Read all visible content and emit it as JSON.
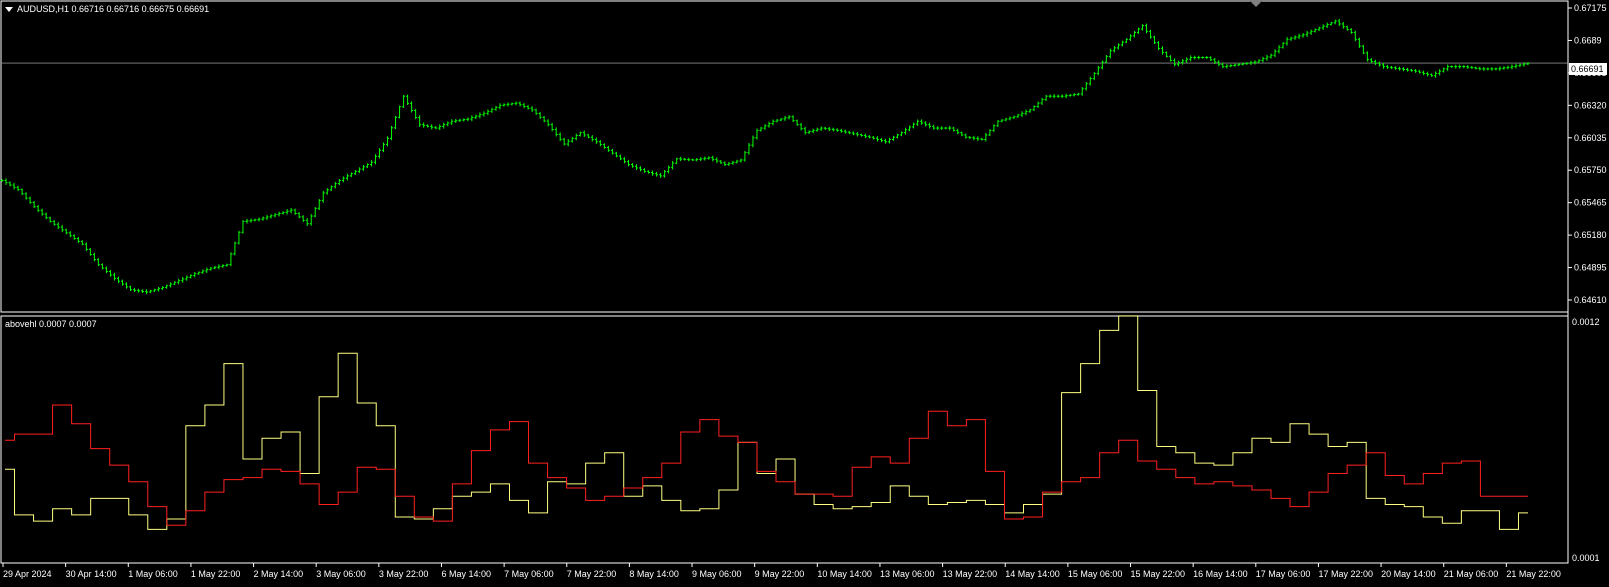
{
  "price_panel": {
    "symbol_header": "AUDUSD,H1  0.66716 0.66716 0.66675 0.66691",
    "current_price_label": "0.66691",
    "current_price": 0.66691,
    "y_ticks": [
      "0.67175",
      "0.6689",
      "0.66605",
      "0.66320",
      "0.66035",
      "0.65750",
      "0.65465",
      "0.65180",
      "0.64895",
      "0.64610"
    ],
    "ylim": [
      0.6461,
      0.67175
    ]
  },
  "indicator_panel": {
    "title": "abovehl 0.0007 0.0007",
    "y_top_label": "0.0012",
    "y_bottom_label": "0.0001",
    "ylim": [
      0.0001,
      0.0012
    ]
  },
  "time_axis": {
    "labels": [
      "29 Apr 2024",
      "30 Apr 14:00",
      "1 May 06:00",
      "1 May 22:00",
      "2 May 14:00",
      "3 May 06:00",
      "3 May 22:00",
      "6 May 14:00",
      "7 May 06:00",
      "7 May 22:00",
      "8 May 14:00",
      "9 May 06:00",
      "9 May 22:00",
      "10 May 14:00",
      "13 May 06:00",
      "13 May 22:00",
      "14 May 14:00",
      "15 May 06:00",
      "15 May 22:00",
      "16 May 14:00",
      "17 May 06:00",
      "17 May 22:00",
      "20 May 14:00",
      "21 May 06:00",
      "21 May 22:00"
    ]
  },
  "colors": {
    "background": "#000000",
    "candles": "#00ff00",
    "price_line": "#c0c0c0",
    "yellow_line": "#ffff80",
    "red_line": "#ff2020",
    "axis_text": "#ffffff"
  },
  "chart_data": {
    "type": "line",
    "x": "hourly bars 29 Apr 2024 – 21 May 22:00 (approx.)",
    "price_close": [
      0.6566,
      0.6558,
      0.6543,
      0.653,
      0.652,
      0.651,
      0.6492,
      0.648,
      0.647,
      0.6468,
      0.6472,
      0.6478,
      0.6484,
      0.6489,
      0.6492,
      0.653,
      0.6532,
      0.6536,
      0.654,
      0.6528,
      0.6555,
      0.6566,
      0.6574,
      0.6582,
      0.6603,
      0.664,
      0.6615,
      0.6612,
      0.6618,
      0.662,
      0.6625,
      0.6632,
      0.6634,
      0.6628,
      0.6615,
      0.6598,
      0.6608,
      0.66,
      0.659,
      0.658,
      0.6574,
      0.657,
      0.6585,
      0.6584,
      0.6586,
      0.658,
      0.6584,
      0.661,
      0.6618,
      0.6622,
      0.6608,
      0.6612,
      0.661,
      0.6607,
      0.6604,
      0.66,
      0.6608,
      0.6618,
      0.6612,
      0.6612,
      0.6604,
      0.6602,
      0.6618,
      0.6622,
      0.6628,
      0.664,
      0.664,
      0.6642,
      0.666,
      0.668,
      0.669,
      0.6702,
      0.6682,
      0.6668,
      0.6674,
      0.6674,
      0.6666,
      0.6668,
      0.667,
      0.6676,
      0.669,
      0.6694,
      0.67,
      0.6706,
      0.6696,
      0.6672,
      0.6666,
      0.6664,
      0.6662,
      0.6658,
      0.6666,
      0.6666,
      0.6664,
      0.6664,
      0.6666,
      0.6669
    ],
    "series": [
      {
        "name": "",
        "color": "yellow",
        "values": [
          0.00047,
          0.00025,
          0.00022,
          0.00028,
          0.00025,
          0.00033,
          0.00033,
          0.00025,
          0.00018,
          0.00023,
          0.00068,
          0.00078,
          0.00098,
          0.00052,
          0.00062,
          0.00065,
          0.00045,
          0.00082,
          0.00103,
          0.00079,
          0.00068,
          0.00024,
          0.00023,
          0.00028,
          0.00034,
          0.00036,
          0.0004,
          0.00032,
          0.00026,
          0.00041,
          0.0004,
          0.0005,
          0.00055,
          0.00034,
          0.00039,
          0.00032,
          0.00027,
          0.00028,
          0.00037,
          0.0006,
          0.00045,
          0.00052,
          0.00035,
          0.0003,
          0.00028,
          0.00029,
          0.00031,
          0.00039,
          0.00034,
          0.0003,
          0.00031,
          0.00032,
          0.0003,
          0.00026,
          0.0003,
          0.00035,
          0.00084,
          0.00098,
          0.00114,
          0.00121,
          0.00085,
          0.00058,
          0.00055,
          0.0005,
          0.00049,
          0.00055,
          0.00062,
          0.0006,
          0.00069,
          0.00064,
          0.00058,
          0.0006,
          0.00033,
          0.0003,
          0.00029,
          0.00024,
          0.00021,
          0.00027,
          0.00027,
          0.00018,
          0.00026
        ]
      },
      {
        "name": "",
        "color": "red",
        "values": [
          0.00061,
          0.00064,
          0.00064,
          0.00078,
          0.00069,
          0.00057,
          0.00049,
          0.00041,
          0.00029,
          0.0002,
          0.00027,
          0.00036,
          0.00042,
          0.00043,
          0.00047,
          0.00046,
          0.0004,
          0.0003,
          0.00036,
          0.00048,
          0.00047,
          0.00034,
          0.00024,
          0.00022,
          0.0004,
          0.00056,
          0.00066,
          0.0007,
          0.0005,
          0.00043,
          0.00038,
          0.00032,
          0.00034,
          0.00038,
          0.00043,
          0.0005,
          0.00065,
          0.00071,
          0.00063,
          0.0006,
          0.00046,
          0.00041,
          0.00035,
          0.00035,
          0.00034,
          0.00048,
          0.00053,
          0.0005,
          0.00062,
          0.00075,
          0.00068,
          0.00071,
          0.00046,
          0.00023,
          0.00024,
          0.00036,
          0.00041,
          0.00043,
          0.00055,
          0.00061,
          0.00051,
          0.00047,
          0.00043,
          0.0004,
          0.00041,
          0.00039,
          0.00037,
          0.00033,
          0.00029,
          0.00036,
          0.00045,
          0.00049,
          0.00055,
          0.00044,
          0.0004,
          0.00045,
          0.0005,
          0.00051,
          0.00034,
          0.00034,
          0.00034
        ]
      }
    ]
  }
}
